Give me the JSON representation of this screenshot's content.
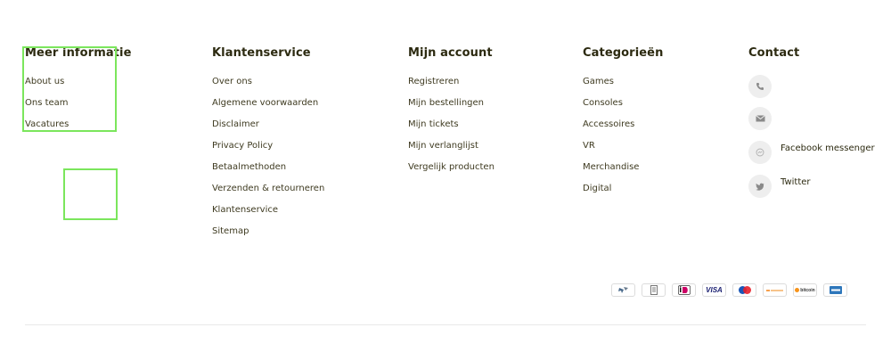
{
  "footer": {
    "columns": [
      {
        "title": "Meer informatie",
        "links": [
          "About us",
          "Ons team",
          "Vacatures"
        ]
      },
      {
        "title": "Klantenservice",
        "links": [
          "Over ons",
          "Algemene voorwaarden",
          "Disclaimer",
          "Privacy Policy",
          "Betaalmethoden",
          "Verzenden & retourneren",
          "Klantenservice",
          "Sitemap"
        ]
      },
      {
        "title": "Mijn account",
        "links": [
          "Registreren",
          "Mijn bestellingen",
          "Mijn tickets",
          "Mijn verlanglijst",
          "Vergelijk producten"
        ]
      },
      {
        "title": "Categorieën",
        "links": [
          "Games",
          "Consoles",
          "Accessoires",
          "VR",
          "Merchandise",
          "Digital"
        ]
      }
    ],
    "contact": {
      "title": "Contact",
      "items": [
        {
          "icon": "phone-icon",
          "label": ""
        },
        {
          "icon": "mail-icon",
          "label": ""
        },
        {
          "icon": "messenger-icon",
          "label": "Facebook messenger"
        },
        {
          "icon": "twitter-icon",
          "label": "Twitter"
        }
      ]
    },
    "payment_methods": [
      {
        "icon": "postnl-icon",
        "text": ""
      },
      {
        "icon": "invoice-icon",
        "text": ""
      },
      {
        "icon": "ideal-icon",
        "text": ""
      },
      {
        "icon": "visa-icon",
        "text": "VISA"
      },
      {
        "icon": "maestro-icon",
        "text": ""
      },
      {
        "icon": "afterpay-icon",
        "text": ""
      },
      {
        "icon": "bitcoin-icon",
        "text": "bitcoin"
      },
      {
        "icon": "amex-icon",
        "text": ""
      }
    ]
  },
  "colors": {
    "text": "#3e3a20",
    "heading": "#2c2a10",
    "highlight": "#7be65c",
    "icon_bg": "#eeeeee"
  }
}
